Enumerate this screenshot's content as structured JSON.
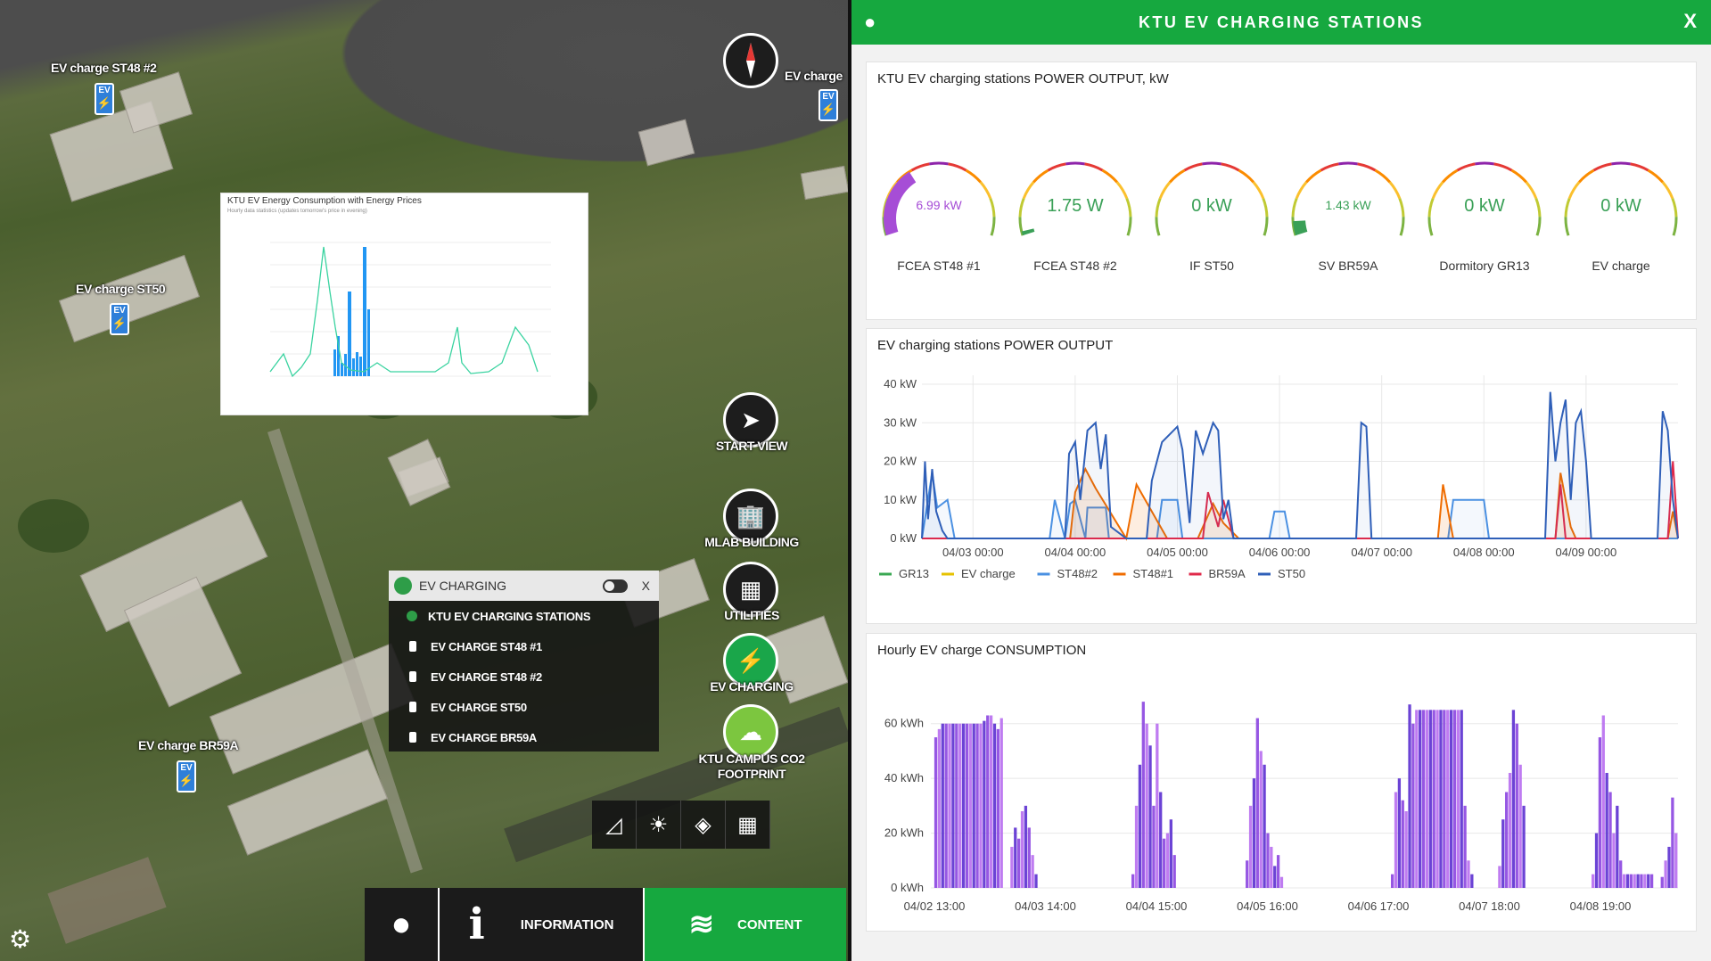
{
  "map": {
    "labels": [
      {
        "text": "EV charge ST48 #2",
        "left": 0
      },
      {
        "text": "EV charge ST50"
      },
      {
        "text": "EV charge BR59A"
      },
      {
        "text": "EV charge"
      }
    ],
    "pin_text": "EV",
    "mini_chart": {
      "title": "KTU EV Energy Consumption with Energy Prices",
      "subtitle": "Hourly data statistics (updates tomorrow's price in evening)"
    }
  },
  "nav": {
    "start_view": "START VIEW",
    "mlab_building": "MLAB BUILDING",
    "utilities": "UTILITIES",
    "ev_charging": "EV CHARGING",
    "campus_co2_1": "KTU CAMPUS CO2",
    "campus_co2_2": "FOOTPRINT"
  },
  "ev_panel": {
    "title": "EV CHARGING",
    "close": "X",
    "items": [
      "KTU EV CHARGING STATIONS",
      "EV CHARGE ST48 #1",
      "EV CHARGE ST48 #2",
      "EV CHARGE ST50",
      "EV CHARGE BR59A"
    ]
  },
  "bottom_bar": {
    "information": "INFORMATION",
    "content": "CONTENT"
  },
  "icons": [
    "compass-icon",
    "paper-plane-icon",
    "building-icon",
    "utilities-icon",
    "ev-station-icon",
    "co2-cloud-icon",
    "measure-icon",
    "sun-icon",
    "layers-icon",
    "grid-icon",
    "map-pin-icon",
    "info-icon",
    "stack-icon",
    "gear-icon",
    "close-icon"
  ],
  "dashboard": {
    "title": "KTU EV CHARGING STATIONS",
    "close": "X",
    "colors": {
      "header": "#16a83f",
      "gauge_green": "#3aa057",
      "gauge_purple": "#a64dd6"
    },
    "gauges_card": {
      "title": "KTU EV charging stations POWER OUTPUT, kW",
      "gauges": [
        {
          "label": "FCEA ST48 #1",
          "value": "6.99 kW",
          "fraction": 0.35,
          "color": "#a64dd6",
          "small": true
        },
        {
          "label": "FCEA ST48 #2",
          "value": "1.75 W",
          "fraction": 0.02,
          "color": "#3aa057",
          "small": false
        },
        {
          "label": "IF ST50",
          "value": "0 kW",
          "fraction": 0,
          "color": "#3aa057",
          "small": false
        },
        {
          "label": "SV BR59A",
          "value": "1.43 kW",
          "fraction": 0.07,
          "color": "#3aa057",
          "small": true
        },
        {
          "label": "Dormitory GR13",
          "value": "0 kW",
          "fraction": 0,
          "color": "#3aa057",
          "small": false
        },
        {
          "label": "EV charge",
          "value": "0 kW",
          "fraction": 0,
          "color": "#3aa057",
          "small": false
        }
      ]
    }
  },
  "chart_data": [
    {
      "type": "line",
      "title": "EV charging stations POWER OUTPUT",
      "y_ticks": [
        "0 kW",
        "10 kW",
        "20 kW",
        "30 kW",
        "40 kW"
      ],
      "ylim": [
        0,
        40
      ],
      "x_ticks": [
        "04/03 00:00",
        "04/04 00:00",
        "04/05 00:00",
        "04/06 00:00",
        "04/07 00:00",
        "04/08 00:00",
        "04/09 00:00"
      ],
      "xlim": [
        0,
        7.4
      ],
      "grid": true,
      "legend_position": "bottom-left",
      "series": [
        {
          "name": "GR13",
          "color": "#3aa853",
          "x": [
            0,
            7.4
          ],
          "y": [
            0,
            0
          ]
        },
        {
          "name": "EV charge",
          "color": "#e6c200",
          "x": [
            0,
            7.4
          ],
          "y": [
            0,
            0
          ]
        },
        {
          "name": "ST48#2",
          "color": "#4a90e2",
          "x": [
            0,
            0.1,
            0.15,
            0.25,
            0.32,
            0.6,
            1.25,
            1.3,
            1.4,
            1.45,
            1.5,
            1.6,
            1.62,
            1.8,
            1.83,
            2.0,
            2.3,
            2.35,
            2.5,
            2.55,
            2.7,
            2.75,
            3.4,
            3.45,
            3.55,
            3.6,
            4.3,
            4.35,
            4.55,
            4.6,
            5.15,
            5.2,
            5.5,
            5.55,
            6.3,
            6.35,
            6.5,
            6.6,
            7.1,
            7.4
          ],
          "y": [
            0,
            17,
            8,
            10,
            0,
            0,
            0,
            10,
            0,
            9,
            10,
            0,
            8,
            8,
            0,
            0,
            0,
            10,
            10,
            0,
            0,
            0,
            0,
            7,
            7,
            0,
            0,
            0,
            0,
            0,
            0,
            10,
            10,
            0,
            0,
            0,
            0,
            0,
            0,
            0
          ]
        },
        {
          "name": "ST48#1",
          "color": "#ef6c00",
          "x": [
            0,
            0.05,
            1.45,
            1.5,
            1.6,
            1.7,
            2.0,
            2.1,
            2.4,
            2.45,
            2.6,
            2.7,
            2.85,
            2.95,
            3.1,
            5.05,
            5.1,
            5.2,
            6.2,
            6.25,
            6.35,
            6.4,
            7.3,
            7.35,
            7.4
          ],
          "y": [
            0,
            0,
            0,
            12,
            18,
            13,
            0,
            14,
            0,
            0,
            0,
            0,
            9,
            4,
            0,
            0,
            14,
            0,
            0,
            17,
            3,
            0,
            0,
            7,
            0
          ]
        },
        {
          "name": "BR59A",
          "color": "#e0294a",
          "x": [
            0,
            2.75,
            2.8,
            2.9,
            2.95,
            3.05,
            6.2,
            6.25,
            6.3,
            7.3,
            7.35,
            7.4
          ],
          "y": [
            0,
            0,
            12,
            3,
            10,
            0,
            0,
            14,
            0,
            0,
            20,
            0
          ]
        },
        {
          "name": "ST50",
          "color": "#2f5fb8",
          "x": [
            0,
            0.03,
            0.06,
            0.1,
            0.14,
            0.2,
            0.25,
            1.4,
            1.44,
            1.5,
            1.55,
            1.62,
            1.7,
            1.75,
            1.8,
            1.85,
            2.0,
            2.1,
            2.2,
            2.25,
            2.35,
            2.5,
            2.55,
            2.62,
            2.68,
            2.75,
            2.85,
            2.9,
            2.95,
            3.0,
            3.05,
            4.25,
            4.3,
            4.35,
            4.4,
            6.1,
            6.15,
            6.2,
            6.25,
            6.3,
            6.35,
            6.4,
            6.45,
            6.5,
            6.55,
            7.2,
            7.25,
            7.3,
            7.35,
            7.4
          ],
          "y": [
            0,
            20,
            5,
            18,
            7,
            2,
            0,
            0,
            22,
            25,
            10,
            28,
            30,
            18,
            27,
            3,
            0,
            0,
            0,
            15,
            25,
            29,
            23,
            4,
            28,
            22,
            30,
            28,
            5,
            10,
            0,
            0,
            30,
            29,
            0,
            0,
            38,
            20,
            30,
            36,
            10,
            30,
            33,
            20,
            0,
            0,
            33,
            28,
            10,
            0
          ]
        }
      ]
    },
    {
      "type": "bar",
      "title": "Hourly EV charge CONSUMPTION",
      "y_ticks": [
        "0 kWh",
        "20 kWh",
        "40 kWh",
        "60 kWh"
      ],
      "ylim": [
        0,
        70
      ],
      "x_ticks": [
        "04/02 13:00",
        "04/03 14:00",
        "04/04 15:00",
        "04/05 16:00",
        "04/06 17:00",
        "04/07 18:00",
        "04/08 19:00"
      ],
      "grid": true,
      "colors": [
        "#5b2fd0",
        "#8b45e0",
        "#b86ef0"
      ],
      "values": [
        0,
        55,
        58,
        60,
        60,
        60,
        60,
        60,
        60,
        60,
        60,
        60,
        60,
        60,
        60,
        61,
        63,
        63,
        60,
        58,
        62,
        0,
        0,
        15,
        22,
        18,
        28,
        30,
        22,
        12,
        5,
        0,
        0,
        0,
        0,
        0,
        0,
        0,
        0,
        0,
        0,
        0,
        0,
        0,
        0,
        0,
        0,
        0,
        0,
        0,
        0,
        0,
        0,
        0,
        0,
        0,
        0,
        0,
        5,
        30,
        45,
        68,
        60,
        52,
        30,
        60,
        35,
        18,
        20,
        25,
        12,
        0,
        0,
        0,
        0,
        0,
        0,
        0,
        0,
        0,
        0,
        0,
        0,
        0,
        0,
        0,
        0,
        0,
        0,
        0,
        0,
        10,
        30,
        40,
        62,
        50,
        45,
        20,
        15,
        8,
        12,
        4,
        0,
        0,
        0,
        0,
        0,
        0,
        0,
        0,
        0,
        0,
        0,
        0,
        0,
        0,
        0,
        0,
        0,
        0,
        0,
        0,
        0,
        0,
        0,
        0,
        0,
        0,
        0,
        0,
        0,
        0,
        0,
        5,
        35,
        40,
        32,
        28,
        67,
        60,
        65,
        65,
        65,
        65,
        65,
        65,
        65,
        65,
        65,
        65,
        65,
        65,
        65,
        65,
        30,
        10,
        5,
        0,
        0,
        0,
        0,
        0,
        0,
        0,
        8,
        25,
        35,
        42,
        65,
        60,
        45,
        30,
        0,
        0,
        0,
        0,
        0,
        0,
        0,
        0,
        0,
        0,
        0,
        0,
        0,
        0,
        0,
        0,
        0,
        0,
        0,
        5,
        20,
        55,
        63,
        42,
        35,
        20,
        30,
        10,
        5,
        5,
        5,
        5,
        5,
        5,
        5,
        5,
        5,
        0,
        0,
        4,
        10,
        15,
        33,
        20
      ]
    }
  ]
}
